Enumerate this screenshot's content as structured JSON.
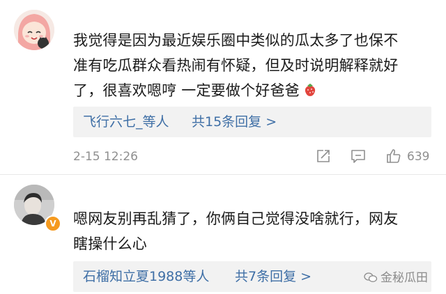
{
  "comments": [
    {
      "lines": [
        "我觉得是因为最近娱乐圈中类似的瓜太多了也保不",
        "准有吃瓜群众看热闹有怀疑，但及时说明解释就好",
        "了，很喜欢嗯哼 一定要做个好爸爸"
      ],
      "emoji": "strawberry-emoji",
      "replies_users": "飞行六七_等人",
      "replies_count": "共15条回复 >",
      "timestamp": "2-15 12:26",
      "likes": "639"
    },
    {
      "lines": [
        "嗯网友别再乱猜了，你俩自己觉得没啥就行，网友",
        "瞎操什么心"
      ],
      "replies_users": "石榴知立夏1988等人",
      "replies_count": "共7条回复 >"
    }
  ],
  "watermark": "金秘瓜田",
  "colors": {
    "link": "#3f6fa6",
    "meta": "#8f8f8f",
    "reply_bg": "#f2f2f2",
    "verified": "#f59a1f"
  }
}
